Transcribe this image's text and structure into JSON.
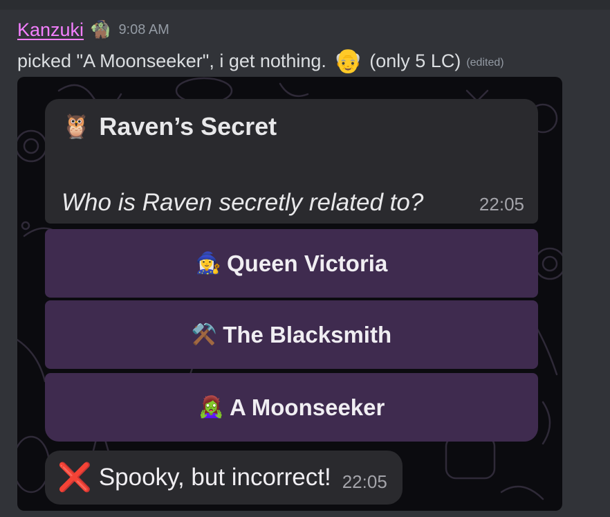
{
  "message": {
    "username": "Kanzuki",
    "user_emoji": "🧌",
    "timestamp": "9:08 AM",
    "text": "picked \"A Moonseeker\", i get nothing.",
    "face_emoji": "👴",
    "suffix_text": "(only 5 LC)",
    "edited_label": "(edited)"
  },
  "embed": {
    "poll": {
      "icon_emoji": "🦉",
      "title": "Raven’s Secret",
      "question": "Who is Raven secretly related to?",
      "time": "22:05"
    },
    "options": [
      {
        "emoji": "🧙‍♀️",
        "label": "Queen Victoria"
      },
      {
        "emoji": "⚒️",
        "label": "The Blacksmith"
      },
      {
        "emoji": "🧟‍♀️",
        "label": "A Moonseeker"
      }
    ],
    "result": {
      "icon": "❌",
      "text": "Spooky, but incorrect!",
      "time": "22:05"
    }
  },
  "colors": {
    "background": "#313338",
    "username": "#f47fff",
    "option_bg": "#3f2b4f",
    "card_bg": "#2a2a2e",
    "incorrect": "#e53935"
  }
}
